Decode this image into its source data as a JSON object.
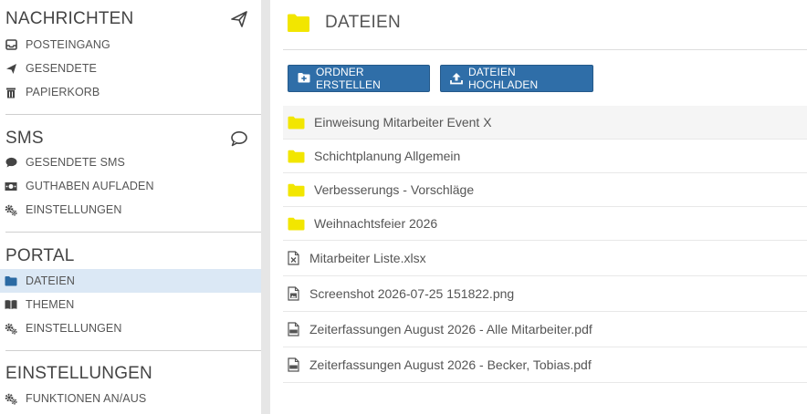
{
  "sidebar": {
    "sections": [
      {
        "title": "NACHRICHTEN",
        "items": [
          "POSTEINGANG",
          "GESENDETE",
          "PAPIERKORB"
        ]
      },
      {
        "title": "SMS",
        "items": [
          "GESENDETE SMS",
          "GUTHABEN AUFLADEN",
          "EINSTELLUNGEN"
        ]
      },
      {
        "title": "PORTAL",
        "items": [
          "DATEIEN",
          "THEMEN",
          "EINSTELLUNGEN"
        ]
      },
      {
        "title": "EINSTELLUNGEN",
        "items": [
          "FUNKTIONEN AN/AUS"
        ]
      }
    ]
  },
  "main": {
    "title": "DATEIEN",
    "buttons": {
      "create_folder": "ORDNER ERSTELLEN",
      "upload": "DATEIEN HOCHLADEN"
    },
    "files": [
      {
        "name": "Einweisung Mitarbeiter Event X",
        "type": "folder"
      },
      {
        "name": "Schichtplanung Allgemein",
        "type": "folder"
      },
      {
        "name": "Verbesserungs - Vorschläge",
        "type": "folder"
      },
      {
        "name": "Weihnachtsfeier 2026",
        "type": "folder"
      },
      {
        "name": "Mitarbeiter Liste.xlsx",
        "type": "xlsx"
      },
      {
        "name": "Screenshot 2026-07-25 151822.png",
        "type": "image"
      },
      {
        "name": "Zeiterfassungen August 2026 - Alle Mitarbeiter.pdf",
        "type": "pdf"
      },
      {
        "name": "Zeiterfassungen August 2026 - Becker, Tobias.pdf",
        "type": "pdf"
      }
    ]
  },
  "colors": {
    "accent": "#2f6ea8",
    "folder": "#f2e600",
    "active_bg": "#dbe8f5"
  }
}
